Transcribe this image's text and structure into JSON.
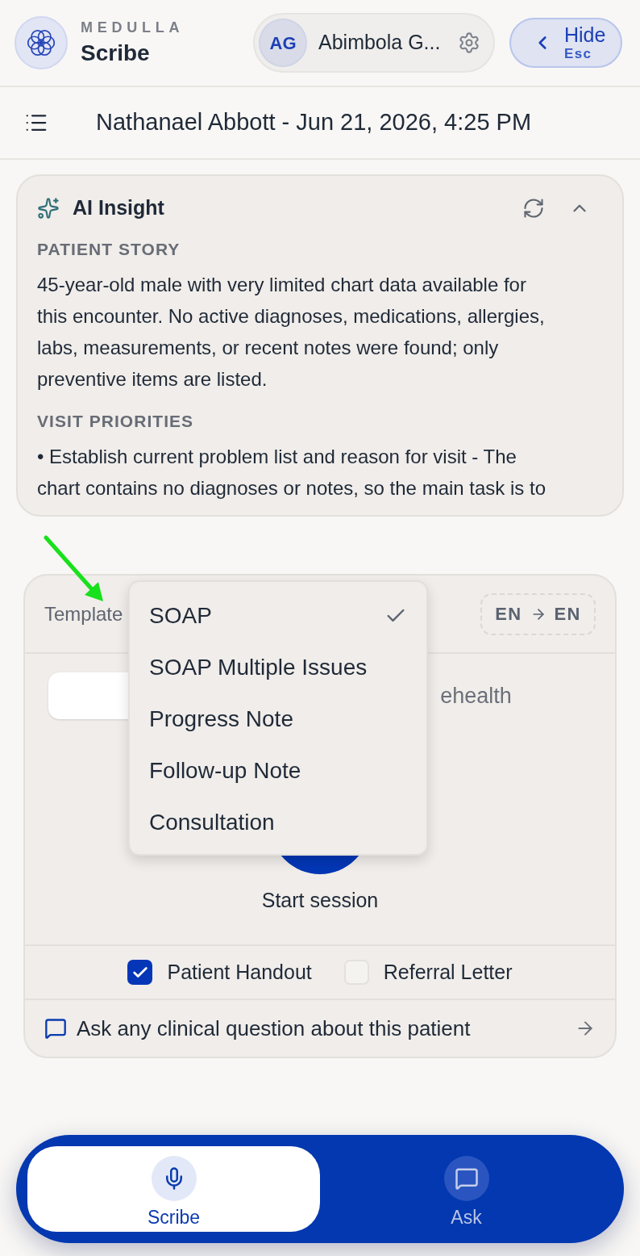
{
  "header": {
    "brand": "MEDULLA",
    "product": "Scribe",
    "user": {
      "initials": "AG",
      "name": "Abimbola G..."
    },
    "hide_button": {
      "label": "Hide",
      "shortcut": "Esc"
    }
  },
  "encounter": {
    "title": "Nathanael Abbott - Jun 21, 2026, 4:25 PM"
  },
  "ai_insight": {
    "title": "AI Insight",
    "expanded": true,
    "sections": [
      {
        "heading": "PATIENT STORY",
        "text": "45-year-old male with very limited chart data available for this encounter. No active diagnoses, medications, allergies, labs, measurements, or recent notes were found; only preventive items are listed."
      },
      {
        "heading": "VISIT PRIORITIES",
        "text": "• Establish current problem list and reason for visit - The chart contains no diagnoses or notes, so the main task is to"
      }
    ]
  },
  "session_card": {
    "template_label": "Template",
    "language": {
      "source": "EN",
      "target": "EN"
    },
    "visit_type": [
      {
        "selected": true
      },
      {
        "label": "ehealth",
        "selected": false
      }
    ],
    "start_label": "Start session",
    "outputs": [
      {
        "label": "Patient Handout",
        "checked": true
      },
      {
        "label": "Referral Letter",
        "checked": false
      }
    ],
    "ask_prompt": "Ask any clinical question about this patient"
  },
  "template_menu": {
    "items": [
      {
        "label": "SOAP",
        "selected": true
      },
      {
        "label": "SOAP Multiple Issues",
        "selected": false
      },
      {
        "label": "Progress Note",
        "selected": false
      },
      {
        "label": "Follow-up Note",
        "selected": false
      },
      {
        "label": "Consultation",
        "selected": false
      }
    ]
  },
  "bottom_nav": {
    "tabs": [
      {
        "kind": "mic",
        "label": "Scribe",
        "selected": true
      },
      {
        "kind": "chat",
        "label": "Ask",
        "selected": false
      }
    ]
  }
}
